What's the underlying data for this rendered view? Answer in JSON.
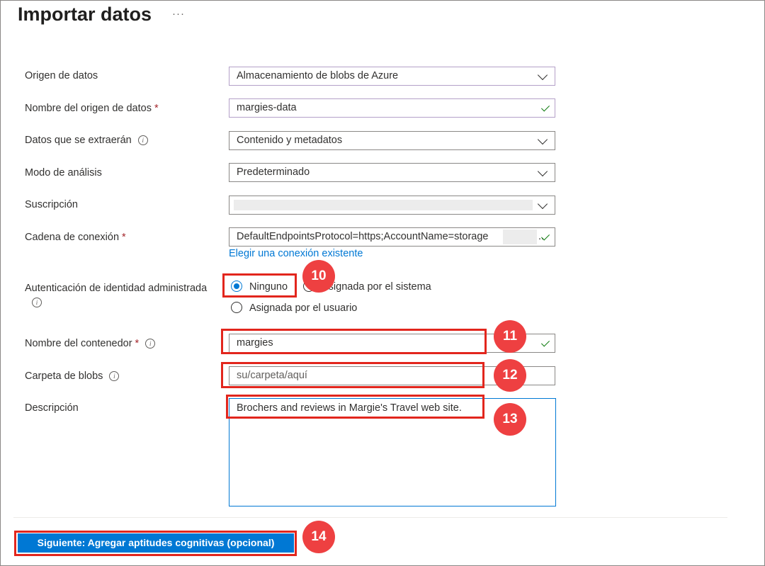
{
  "header": {
    "title": "Importar datos",
    "more": "···"
  },
  "form": {
    "data_source": {
      "label": "Origen de datos",
      "value": "Almacenamiento de blobs de Azure"
    },
    "data_source_name": {
      "label": "Nombre del origen de datos",
      "required": "*",
      "value": "margies-data"
    },
    "data_to_extract": {
      "label": "Datos que se extraerán",
      "value": "Contenido y metadatos"
    },
    "parsing_mode": {
      "label": "Modo de análisis",
      "value": "Predeterminado"
    },
    "subscription": {
      "label": "Suscripción",
      "value": ""
    },
    "connection_string": {
      "label": "Cadena de conexión",
      "required": "*",
      "value": "DefaultEndpointsProtocol=https;AccountName=storage",
      "ellipsis": "..",
      "link": "Elegir una conexión existente"
    },
    "managed_identity": {
      "label": "Autenticación de identidad administrada",
      "options": [
        "Ninguno",
        "Asignada por el sistema",
        "Asignada por el usuario"
      ],
      "selected": "Ninguno"
    },
    "container_name": {
      "label": "Nombre del contenedor",
      "required": "*",
      "value": "margies"
    },
    "blob_folder": {
      "label": "Carpeta de blobs",
      "placeholder": "su/carpeta/aquí"
    },
    "description": {
      "label": "Descripción",
      "value": "Brochers and reviews in Margie's Travel web site."
    }
  },
  "footer": {
    "next_button": "Siguiente: Agregar aptitudes cognitivas (opcional)"
  },
  "annotations": {
    "badges": [
      "10",
      "11",
      "12",
      "13",
      "14"
    ],
    "color": "#ee4041"
  },
  "colors": {
    "accent": "#0078d4",
    "valid": "#107c10",
    "required": "#a4262c",
    "highlight": "#e2261d"
  },
  "icons": {
    "dropdown": "chevron-down-icon",
    "valid": "checkmark-icon",
    "info": "info-icon",
    "more": "more-icon"
  }
}
